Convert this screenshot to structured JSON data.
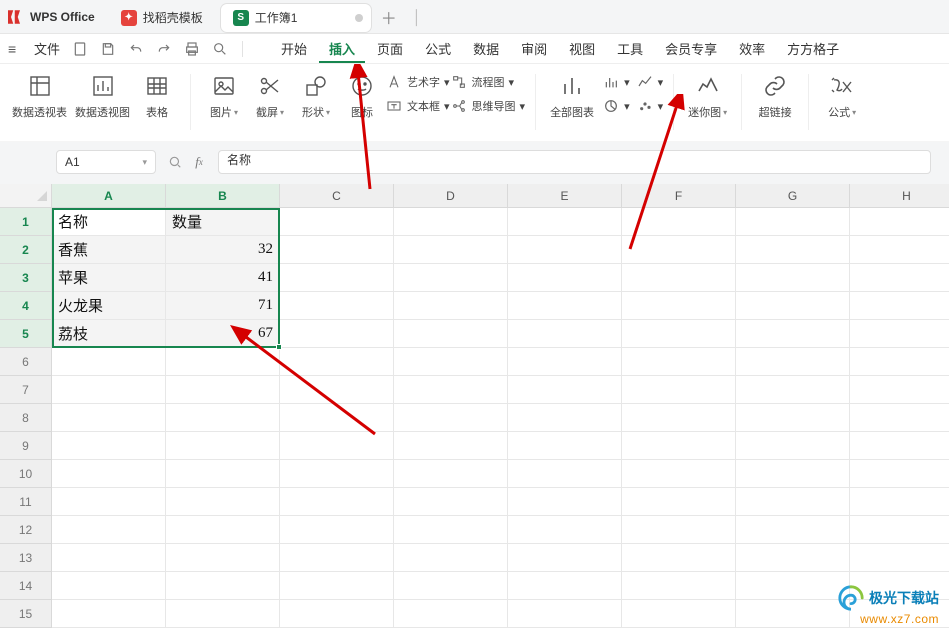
{
  "app": {
    "name": "WPS Office"
  },
  "tabs": {
    "template": {
      "label": "找稻壳模板"
    },
    "doc": {
      "label": "工作簿1",
      "badge": "S"
    }
  },
  "menubar": {
    "file": "文件",
    "items": [
      "开始",
      "插入",
      "页面",
      "公式",
      "数据",
      "审阅",
      "视图",
      "工具",
      "会员专享",
      "效率",
      "方方格子"
    ],
    "activeIndex": 1
  },
  "ribbon": {
    "pivot_table": "数据透视表",
    "pivot_chart": "数据透视图",
    "table": "表格",
    "picture": "图片",
    "screenshot": "截屏",
    "shape": "形状",
    "icon": "图标",
    "wordart": "艺术字",
    "textbox": "文本框",
    "flowchart": "流程图",
    "mindmap": "思维导图",
    "all_charts": "全部图表",
    "mini_chart": "迷你图",
    "link": "超链接",
    "formula": "公式"
  },
  "namebox": {
    "value": "A1"
  },
  "formula": {
    "value": "名称"
  },
  "grid": {
    "cols": [
      "A",
      "B",
      "C",
      "D",
      "E",
      "F",
      "G",
      "H"
    ],
    "rows": [
      "1",
      "2",
      "3",
      "4",
      "5",
      "6",
      "7",
      "8",
      "9",
      "10",
      "11",
      "12",
      "13",
      "14",
      "15"
    ],
    "selCols": 2,
    "selRows": 5
  },
  "chart_data": {
    "type": "table",
    "headers": [
      "名称",
      "数量"
    ],
    "rows": [
      {
        "name": "香蕉",
        "qty": 32
      },
      {
        "name": "苹果",
        "qty": 41
      },
      {
        "name": "火龙果",
        "qty": 71
      },
      {
        "name": "荔枝",
        "qty": 67
      }
    ]
  },
  "watermark": {
    "site": "极光下载站",
    "url": "www.xz7.com"
  }
}
